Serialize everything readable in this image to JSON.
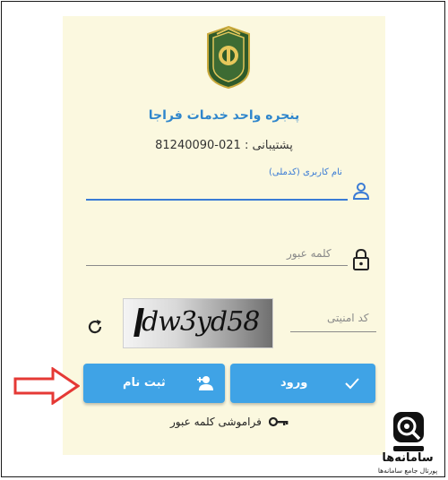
{
  "header": {
    "title": "پنجره واحد خدمات فراجا",
    "support": "پشتیبانی : 021-81240090"
  },
  "form": {
    "username_label": "نام کاربری (کدملی)",
    "password_placeholder": "کلمه عبور",
    "captcha_placeholder": "کد امنیتی",
    "captcha_code": "dw3yd58"
  },
  "buttons": {
    "register_label": "ثبت نام",
    "login_label": "ورود"
  },
  "links": {
    "forgot_password": "فراموشی کلمه عبور"
  },
  "watermark": {
    "name": "سامانه‌ها",
    "subtitle": "پورتال جامع سامانه‌ها"
  },
  "icons": [
    "police-emblem-icon",
    "user-icon",
    "lock-icon",
    "refresh-icon",
    "add-user-icon",
    "check-icon",
    "key-icon",
    "arrow-icon",
    "portal-logo-icon"
  ],
  "colors": {
    "accent": "#3fa3e6",
    "panel": "#fbf8df",
    "arrow": "#e53935"
  }
}
